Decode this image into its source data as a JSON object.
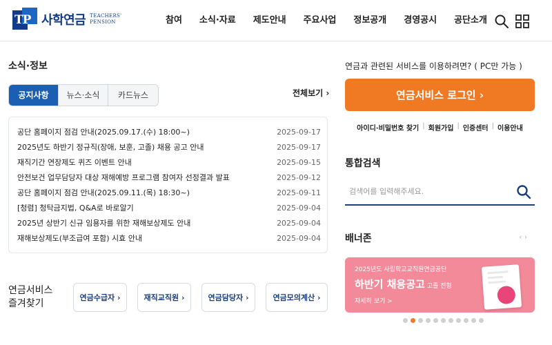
{
  "header": {
    "logo_name": "사학연금",
    "logo_eng_line1": "TEACHERS'",
    "logo_eng_line2": "PENSION",
    "logo_mark": "TP",
    "nav": [
      "참여",
      "소식·자료",
      "제도안내",
      "주요사업",
      "정보공개",
      "경영공시",
      "공단소개"
    ],
    "icons": [
      "search-icon",
      "grid-menu-icon"
    ]
  },
  "news": {
    "section_title": "소식·정보",
    "tabs": [
      "공지사항",
      "뉴스·소식",
      "카드뉴스"
    ],
    "active_tab": 0,
    "more_label": "전체보기",
    "items": [
      {
        "title": "공단 홈페이지 점검 안내(2025.09.17.(수) 18:00~)",
        "date": "2025-09-17"
      },
      {
        "title": "2025년도 하반기 정규직(장애, 보훈, 고졸) 채용 공고 안내",
        "date": "2025-09-17"
      },
      {
        "title": "재직기간 연장제도 퀴즈 이벤트 안내",
        "date": "2025-09-15"
      },
      {
        "title": "안전보건 업무담당자 대상 재해예방 프로그램 참여자 선정결과 발표",
        "date": "2025-09-12"
      },
      {
        "title": "공단 홈페이지 점검 안내(2025.09.11.(목) 18:30~)",
        "date": "2025-09-11"
      },
      {
        "title": "[청렴] 청탁금지법, Q&A로 바로알기",
        "date": "2025-09-04"
      },
      {
        "title": "2025년 상반기 신규 임용자를 위한 재해보상제도 안내",
        "date": "2025-09-04"
      },
      {
        "title": "재해보상제도(부조급여 포함) 시효 안내",
        "date": "2025-09-04"
      }
    ]
  },
  "favorites": {
    "label_line1": "연금서비스",
    "label_line2": "즐겨찾기",
    "buttons": [
      "연금수급자",
      "재직교직원",
      "연금담당자",
      "연금모의계산"
    ]
  },
  "service": {
    "intro": "연금과 관련된 서비스를 이용하려면? ( PC만 가능 )",
    "login_label": "연금서비스 로그인",
    "links": [
      "아이디·비밀번호 찾기",
      "회원가입",
      "인증센터",
      "이용안내"
    ]
  },
  "search": {
    "title": "통합검색",
    "placeholder": "검색어를 입력해주세요."
  },
  "banner": {
    "title": "배너존",
    "arrows": "‹ ›",
    "sub": "2025년도 사립학교교직원연금공단",
    "main": "하반기 채용공고",
    "main_small": "고졸 전형",
    "more": "자세히 보기 >",
    "dot_count": 11,
    "active_dot": 1
  },
  "colors": {
    "brand_blue": "#1a5fb4",
    "navy": "#123a86",
    "orange": "#f07a23",
    "banner_pink": "#f28a9a"
  }
}
